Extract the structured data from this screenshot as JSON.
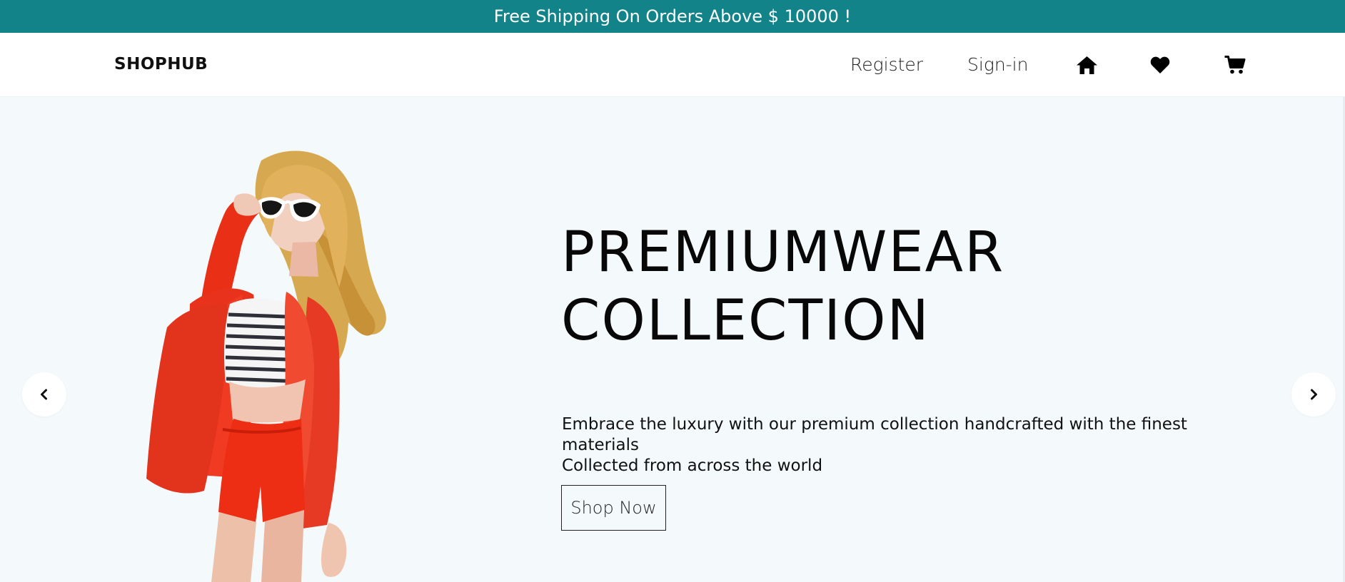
{
  "announcement": {
    "text": "Free Shipping On Orders Above $ 10000 !",
    "background": "#13838a"
  },
  "navbar": {
    "logo": "SHOPHUB",
    "links": {
      "register": "Register",
      "signin": "Sign-in"
    },
    "icons": [
      "home-icon",
      "heart-icon",
      "cart-icon"
    ]
  },
  "hero": {
    "title_line1": "PREMIUMWEAR",
    "title_line2": "COLLECTION",
    "description_line1": "Embrace the luxury with our premium collection handcrafted with the finest materials",
    "description_line2": "Collected from across the world",
    "cta_label": "Shop Now",
    "background": "#f4f9fb",
    "image": "model-in-red-blazer-and-sunglasses"
  },
  "carousel": {
    "prev_icon": "chevron-left-icon",
    "next_icon": "chevron-right-icon"
  }
}
